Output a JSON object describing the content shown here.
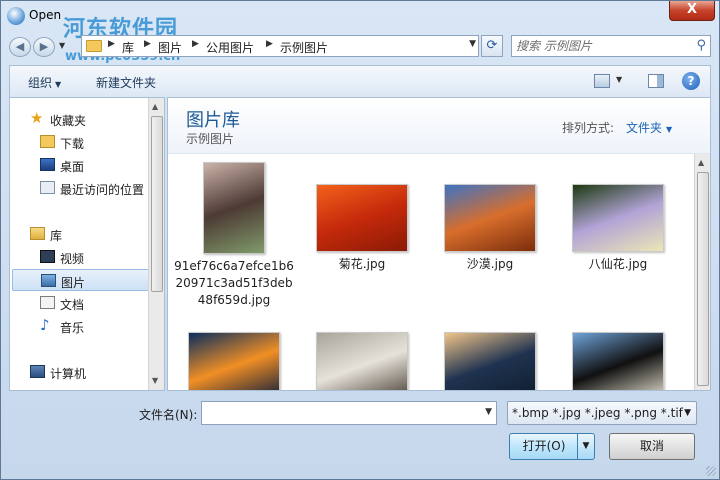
{
  "window": {
    "title": "Open",
    "close_glyph": "X"
  },
  "watermark": {
    "logo": "河东软件园",
    "url": "www.pc0359.cn"
  },
  "address": {
    "crumbs": [
      "库",
      "图片",
      "公用图片",
      "示例图片"
    ]
  },
  "search": {
    "placeholder": "搜索 示例图片"
  },
  "toolbar": {
    "organize_label": "组织",
    "new_folder_label": "新建文件夹"
  },
  "nav": {
    "favorites": {
      "label": "收藏夹",
      "items": [
        "下载",
        "桌面",
        "最近访问的位置"
      ]
    },
    "libraries": {
      "label": "库",
      "items": [
        "视频",
        "图片",
        "文档",
        "音乐"
      ]
    },
    "computer": {
      "label": "计算机"
    },
    "selected": "图片"
  },
  "library": {
    "title": "图片库",
    "subtitle": "示例图片",
    "arrange_label": "排列方式:",
    "arrange_value": "文件夹"
  },
  "files": [
    {
      "name": "91ef76c6a7efce1b620971c3ad51f3deb48f659d.jpg",
      "colors": [
        "#cbb3a9",
        "#4d3a34",
        "#7f9b6a"
      ]
    },
    {
      "name": "菊花.jpg",
      "colors": [
        "#f2621c",
        "#c62a0b",
        "#8a1a05"
      ]
    },
    {
      "name": "沙漠.jpg",
      "colors": [
        "#3d73c4",
        "#d86e2c",
        "#7b2d0c"
      ]
    },
    {
      "name": "八仙花.jpg",
      "colors": [
        "#1d3a10",
        "#b1a3d6",
        "#ece6b6"
      ]
    },
    {
      "name": "",
      "colors": [
        "#0a2d5e",
        "#f18f24",
        "#0c1b3a"
      ]
    },
    {
      "name": "",
      "colors": [
        "#a8a49c",
        "#e6e2da",
        "#4a4036"
      ]
    },
    {
      "name": "",
      "colors": [
        "#f1c58a",
        "#1f3350",
        "#0e1c2c"
      ]
    },
    {
      "name": "",
      "colors": [
        "#6ea3d8",
        "#101010",
        "#e8e2d0"
      ]
    }
  ],
  "bottom": {
    "filename_label": "文件名(N):",
    "filename_value": "",
    "filter_value": "*.bmp *.jpg *.jpeg *.png *.tif",
    "open_label": "打开(O)",
    "cancel_label": "取消"
  }
}
